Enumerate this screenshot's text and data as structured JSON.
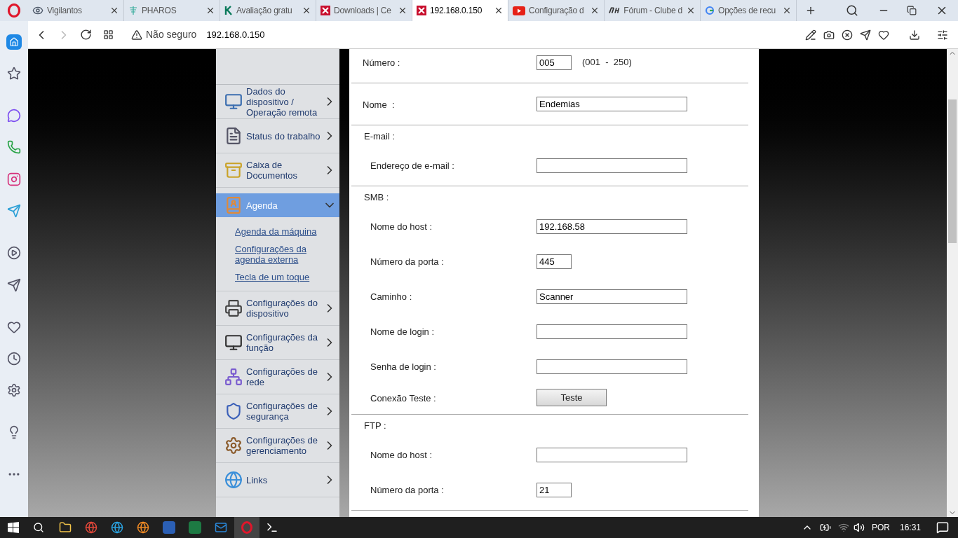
{
  "tabs": [
    {
      "title": "Vigilantos",
      "selected": false
    },
    {
      "title": "PHAROS",
      "selected": false
    },
    {
      "title": "Avaliação gratu",
      "selected": false
    },
    {
      "title": "Downloads | Ce",
      "selected": false
    },
    {
      "title": "192.168.0.150",
      "selected": true
    },
    {
      "title": "Configuração d",
      "selected": false
    },
    {
      "title": "Fórum - Clube d",
      "selected": false
    },
    {
      "title": "Opções de recu",
      "selected": false
    }
  ],
  "address_bar": {
    "security": "Não seguro",
    "url": "192.168.0.150"
  },
  "menu": [
    {
      "label": "Dados do dispositivo / Operação remota",
      "expanded": false
    },
    {
      "label": "Status do trabalho",
      "expanded": false
    },
    {
      "label": "Caixa de Documentos",
      "expanded": false
    },
    {
      "label": "Agenda",
      "expanded": true,
      "children": [
        "Agenda da máquina",
        "Configurações da agenda externa",
        "Tecla de um toque"
      ]
    },
    {
      "label": "Configurações do dispositivo",
      "expanded": false
    },
    {
      "label": "Configurações da função",
      "expanded": false
    },
    {
      "label": "Configurações de rede",
      "expanded": false
    },
    {
      "label": "Configurações de segurança",
      "expanded": false
    },
    {
      "label": "Configurações de gerenciamento",
      "expanded": false
    },
    {
      "label": "Links",
      "expanded": false
    }
  ],
  "form": [
    {
      "rows": [
        {
          "label": "Número :",
          "kind": "short-field",
          "value": "005",
          "suffix": "(001  -  250)"
        }
      ]
    },
    {
      "rows": [
        {
          "label": "Nome  :",
          "kind": "field",
          "value": "Endemias"
        }
      ]
    },
    {
      "heading": "E-mail :",
      "rows": [
        {
          "label": "Endereço de e-mail :",
          "kind": "field"
        }
      ]
    },
    {
      "heading": "SMB :",
      "rows": [
        {
          "label": "Nome do host :",
          "kind": "field",
          "value": "192.168.58"
        },
        {
          "label": "Número da porta :",
          "kind": "short-field",
          "value": "445"
        },
        {
          "label": "Caminho :",
          "kind": "field",
          "value": "Scanner"
        },
        {
          "label": "Nome de login :",
          "kind": "field"
        },
        {
          "label": "Senha de login :",
          "kind": "field"
        },
        {
          "label": "Conexão Teste :",
          "kind": "button",
          "value": "Teste"
        }
      ]
    },
    {
      "heading": "FTP :",
      "rows": [
        {
          "label": "Nome do host :",
          "kind": "field"
        },
        {
          "label": "Número da porta :",
          "kind": "short-field",
          "value": "21"
        }
      ]
    }
  ],
  "taskbar": {
    "language": "POR",
    "time": "16:31"
  }
}
